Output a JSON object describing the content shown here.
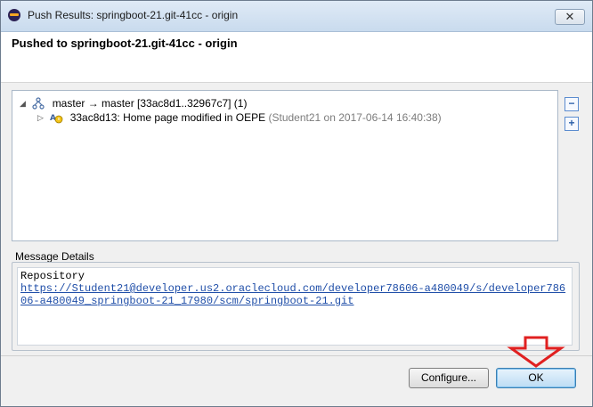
{
  "window": {
    "title": "Push Results: springboot-21.git-41cc - origin",
    "close_glyph": "✕"
  },
  "header": {
    "title": "Pushed to springboot-21.git-41cc - origin"
  },
  "tree": {
    "ref_row": "master → master [33ac8d1..32967c7] (1)",
    "commit_row": {
      "main": "33ac8d13: Home page modified in OEPE",
      "meta": "(Student21 on 2017-06-14 16:40:38)"
    }
  },
  "side_buttons": {
    "collapse_glyph": "−",
    "expand_glyph": "+"
  },
  "message_details": {
    "label": "Message Details",
    "repository_label": "Repository",
    "repository_url": "https://Student21@developer.us2.oraclecloud.com/developer78606-a480049/s/developer78606-a480049_springboot-21_17980/scm/springboot-21.git"
  },
  "buttons": {
    "configure": "Configure...",
    "ok": "OK"
  },
  "colors": {
    "annotation_arrow": "#e02020"
  }
}
